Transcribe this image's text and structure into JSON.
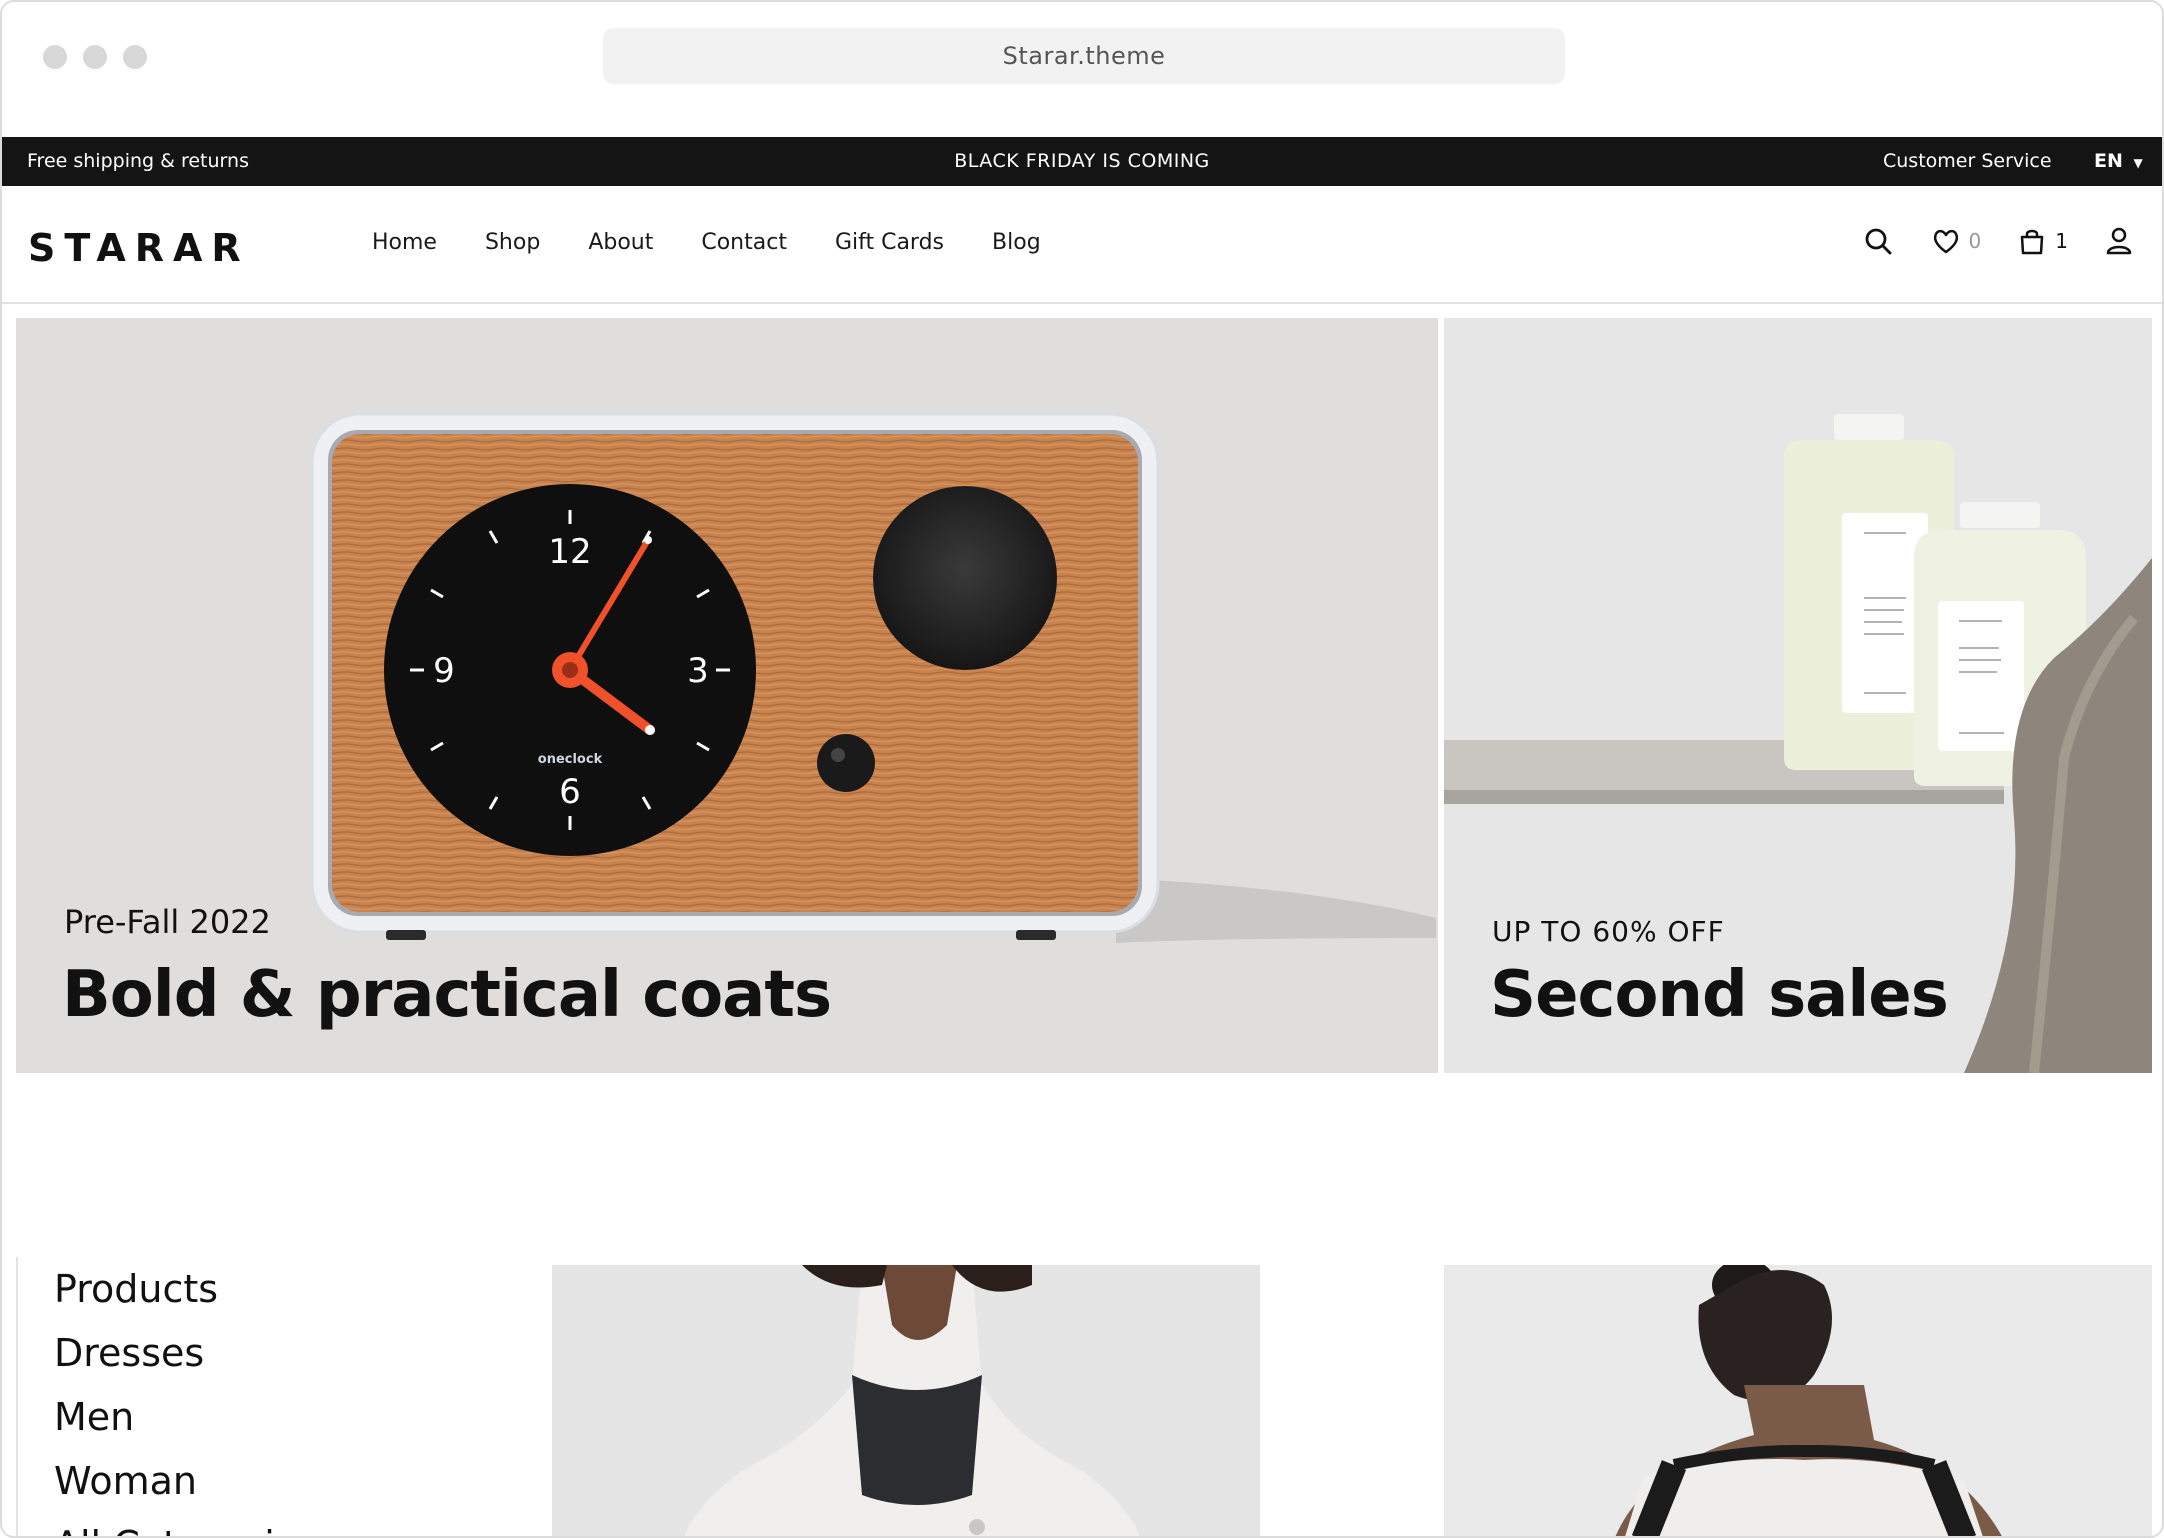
{
  "browser": {
    "url": "Starar.theme"
  },
  "announcement": {
    "left": "Free shipping & returns",
    "center": "BLACK FRIDAY IS COMING",
    "customer_service": "Customer Service",
    "language": "EN"
  },
  "header": {
    "logo": "STARAR",
    "nav": [
      "Home",
      "Shop",
      "About",
      "Contact",
      "Gift Cards",
      "Blog"
    ],
    "wishlist_count": "0",
    "cart_count": "1"
  },
  "hero": {
    "left": {
      "kicker": "Pre-Fall 2022",
      "title": "Bold & practical coats",
      "clock_numbers": [
        "12",
        "3",
        "6",
        "9"
      ],
      "clock_brand": "oneclock"
    },
    "right": {
      "kicker": "UP TO 60% OFF",
      "title": "Second sales"
    }
  },
  "categories": [
    "Products",
    "Dresses",
    "Men",
    "Woman",
    "All Categories"
  ],
  "colors": {
    "topbar": "#141414",
    "hero_bg": "#dfdedc",
    "wood": "#c8834f",
    "clock_hand": "#f0502a"
  }
}
